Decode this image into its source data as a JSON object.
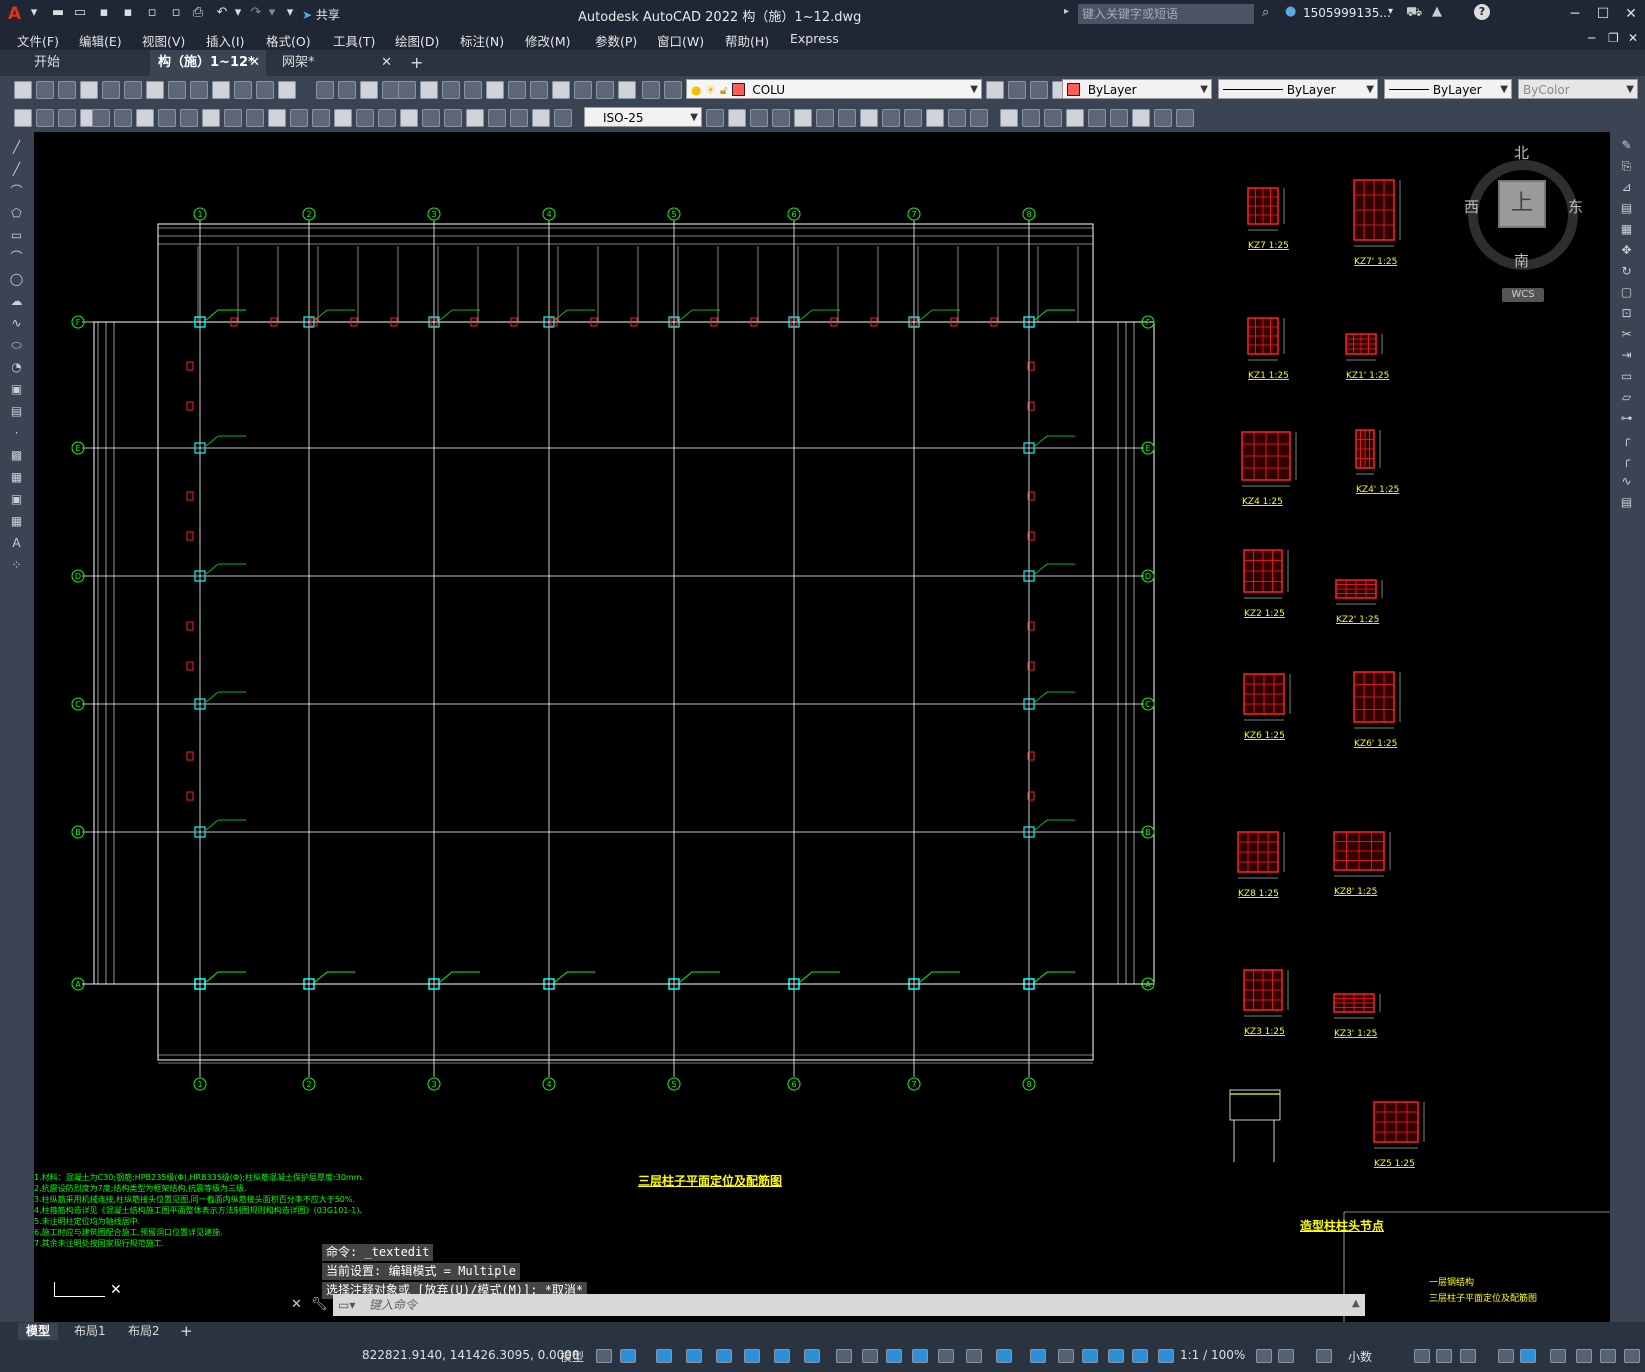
{
  "titlebar": {
    "title": "Autodesk AutoCAD 2022    构（施）1~12.dwg",
    "share": "共享",
    "search_placeholder": "键入关键字或短语",
    "user": "1505999135...",
    "help": "?"
  },
  "menu": [
    "文件(F)",
    "编辑(E)",
    "视图(V)",
    "插入(I)",
    "格式(O)",
    "工具(T)",
    "绘图(D)",
    "标注(N)",
    "修改(M)",
    "参数(P)",
    "窗口(W)",
    "帮助(H)",
    "Express"
  ],
  "tabs": [
    {
      "label": "开始",
      "active": false
    },
    {
      "label": "构（施）1~12*",
      "active": true
    },
    {
      "label": "网架*",
      "active": false
    }
  ],
  "toolbar": {
    "layer": "COLU",
    "color": "ByLayer",
    "linetype": "ByLayer",
    "lineweight": "ByLayer",
    "plotstyle": "ByColor",
    "dimstyle": "ISO-25"
  },
  "viewcube": {
    "north": "北",
    "south": "南",
    "east": "东",
    "west": "西",
    "face": "上",
    "wcs": "WCS"
  },
  "drawing": {
    "title": "三层柱子平面定位及配筋图",
    "node_title": "造型柱柱头节点",
    "grid_numbers": [
      "1",
      "2",
      "3",
      "4",
      "5",
      "6",
      "7",
      "8"
    ],
    "grid_letters": [
      "F",
      "E",
      "D",
      "C",
      "B",
      "A"
    ],
    "details": [
      "KZ7 1:25",
      "KZ7' 1:25",
      "KZ1 1:25",
      "KZ1' 1:25",
      "KZ4 1:25",
      "KZ4' 1:25",
      "KZ2 1:25",
      "KZ2' 1:25",
      "KZ6 1:25",
      "KZ6' 1:25",
      "KZ8 1:25",
      "KZ8' 1:25",
      "KZ3 1:25",
      "KZ3' 1:25",
      "KZ5 1:25"
    ],
    "notes": [
      "1.材料：混凝土为C30;钢筋:HPB235级(Φ),HRB335级(Φ);柱纵筋混凝土保护层厚度:30mm.",
      "2.抗震设防烈度为7度;结构类型为框架结构,抗震等级为三级.",
      "3.柱纵筋采用机械连接,柱纵筋接头位置见图,同一截面内纵筋接头面积百分率不应大于50%.",
      "4.柱箍筋构造详见《混凝土结构施工图平面整体表示方法制图规则和构造详图》(03G101-1).",
      "5.未注明柱定位均为轴线居中.",
      "6.施工时应与建筑图配合施工,预留洞口位置详见建施.",
      "7.其余未注明处按国家现行规范施工."
    ],
    "titleblock": [
      "一层钢结构",
      "三层柱子平面定位及配筋图"
    ]
  },
  "command": {
    "history": [
      "命令: _textedit",
      "当前设置: 编辑模式 = Multiple",
      "选择注释对象或 [放弃(U)/模式(M)]: *取消*"
    ],
    "placeholder": "键入命令"
  },
  "layout_tabs": [
    {
      "label": "模型",
      "active": true
    },
    {
      "label": "布局1",
      "active": false
    },
    {
      "label": "布局2",
      "active": false
    }
  ],
  "status": {
    "coords": "822821.9140, 141426.3095, 0.0000",
    "model": "模型",
    "scale": "1:1 / 100%",
    "units": "小数"
  }
}
